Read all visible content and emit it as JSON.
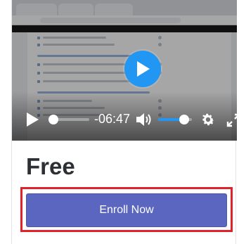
{
  "player": {
    "time_remaining": "-06:47",
    "progress": 0.12,
    "volume": 0.78,
    "accent_color": "#2196f3",
    "icons": [
      "play-icon",
      "big-play-icon",
      "volume-icon",
      "gear-icon",
      "fullscreen-icon"
    ]
  },
  "course": {
    "price": "Free",
    "enroll_label": "Enroll Now",
    "button_color": "#5b66c0",
    "highlight_color": "#e0232b"
  }
}
